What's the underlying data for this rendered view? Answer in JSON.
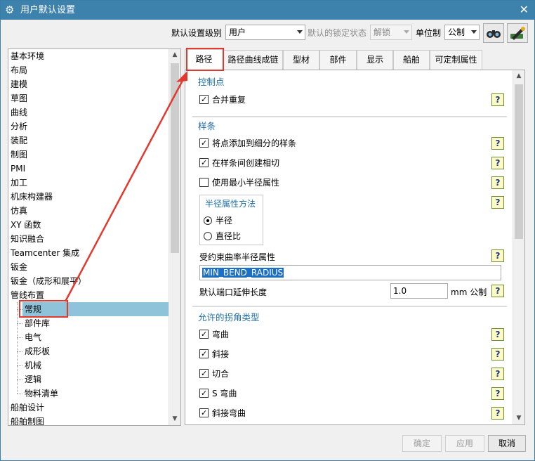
{
  "window": {
    "title": "用户默认设置"
  },
  "toolbar": {
    "level_label": "默认设置级别",
    "level_value": "用户",
    "lock_label": "默认的锁定状态",
    "lock_value": "解锁",
    "unit_label": "单位制",
    "unit_value": "公制"
  },
  "tree": {
    "items": [
      "基本环境",
      "布局",
      "建模",
      "草图",
      "曲线",
      "分析",
      "装配",
      "制图",
      "PMI",
      "加工",
      "机床构建器",
      "仿真",
      "XY 函数",
      "知识融合",
      "Teamcenter 集成",
      "钣金",
      "钣金（成形和展平）",
      "管线布置"
    ],
    "children": [
      "常规",
      "部件库",
      "电气",
      "成形板",
      "机械",
      "逻辑",
      "物料清单"
    ],
    "after": [
      "船舶设计",
      "船舶制图"
    ],
    "selected": "常规"
  },
  "tabs": [
    "路径",
    "路径曲线成链",
    "型材",
    "部件",
    "显示",
    "船舶",
    "可定制属性"
  ],
  "sections": {
    "control_points": {
      "title": "控制点",
      "merge_duplicates": "合并重复"
    },
    "splines": {
      "title": "样条",
      "add_points": "将点添加到细分的样条",
      "create_tangent": "在样条间创建相切",
      "use_min_radius": "使用最小半径属性",
      "radius_method_title": "半径属性方法",
      "radius": "半径",
      "diameter_ratio": "直径比",
      "constrained_label": "受约束曲率半径属性",
      "constrained_value": "MIN_BEND_RADIUS",
      "extend_label": "默认端口延伸长度",
      "extend_value": "1.0",
      "extend_unit": "mm 公制"
    },
    "corners": {
      "title": "允许的拐角类型",
      "items": [
        "弯曲",
        "斜接",
        "切合",
        "S 弯曲",
        "斜接弯曲"
      ]
    }
  },
  "help_mark": "?",
  "buttons": {
    "ok": "确定",
    "apply": "应用",
    "cancel": "取消"
  }
}
